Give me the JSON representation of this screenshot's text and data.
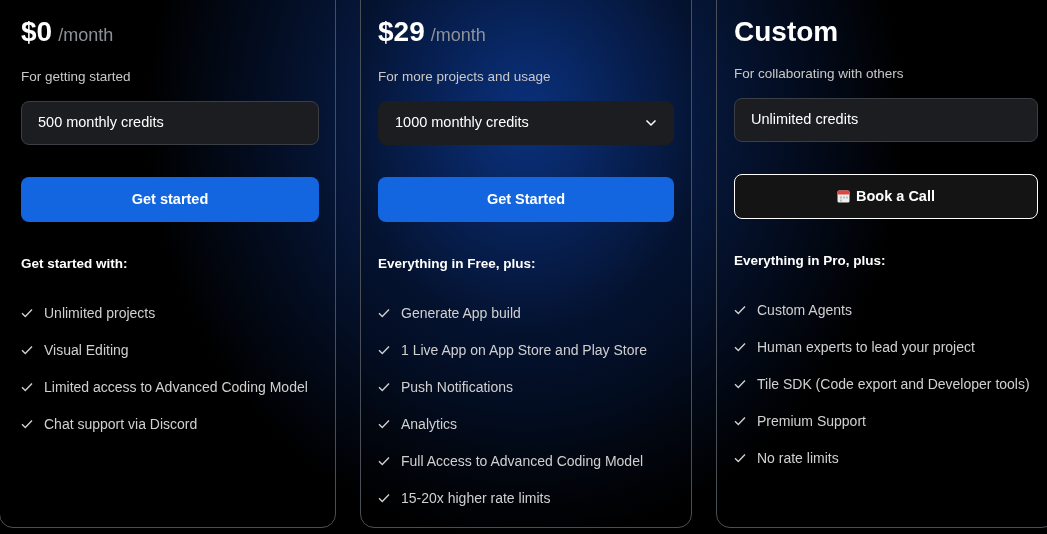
{
  "plans": [
    {
      "price": "$0",
      "period": "/month",
      "subtitle": "For getting started",
      "credits": {
        "text": "500 monthly credits",
        "kind": "static"
      },
      "button": {
        "label": "Get started",
        "kind": "primary"
      },
      "features_heading": "Get started with:",
      "features": [
        "Unlimited projects",
        "Visual Editing",
        "Limited access to Advanced Coding Model",
        "Chat support via Discord"
      ]
    },
    {
      "price": "$29",
      "period": "/month",
      "subtitle": "For more projects and usage",
      "credits": {
        "text": "1000 monthly credits",
        "kind": "select"
      },
      "button": {
        "label": "Get Started",
        "kind": "primary"
      },
      "features_heading": "Everything in Free, plus:",
      "features": [
        "Generate App build",
        "1 Live App on App Store and Play Store",
        "Push Notifications",
        "Analytics",
        "Full Access to Advanced Coding Model",
        "15-20x higher rate limits"
      ]
    },
    {
      "price": "Custom",
      "subtitle": "For collaborating with others",
      "credits": {
        "text": "Unlimited credits",
        "kind": "static"
      },
      "button": {
        "label": "Book a Call",
        "kind": "outline"
      },
      "features_heading": "Everything in Pro, plus:",
      "features": [
        "Custom Agents",
        "Human experts to lead your project",
        "Tile SDK (Code export and Developer tools)",
        "Premium Support",
        "No rate limits"
      ]
    }
  ]
}
